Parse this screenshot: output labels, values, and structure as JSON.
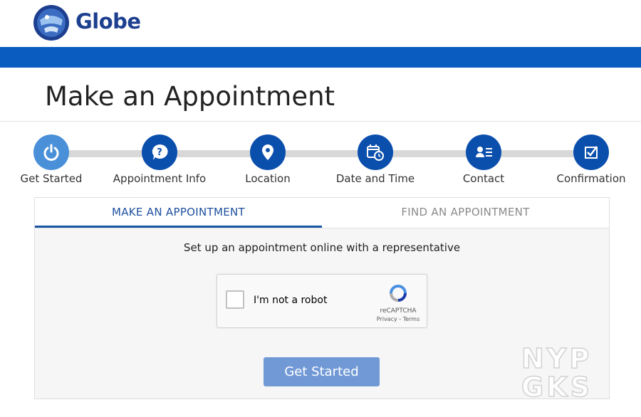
{
  "brand": {
    "name": "Globe",
    "color": "#1d3f8f",
    "bar_color": "#0b5cc0"
  },
  "page": {
    "title": "Make an Appointment"
  },
  "steps": [
    {
      "label": "Get Started",
      "icon": "power-icon",
      "active": true
    },
    {
      "label": "Appointment Info",
      "icon": "question-bubble-icon",
      "active": false
    },
    {
      "label": "Location",
      "icon": "location-pin-icon",
      "active": false
    },
    {
      "label": "Date and Time",
      "icon": "calendar-clock-icon",
      "active": false
    },
    {
      "label": "Contact",
      "icon": "contact-card-icon",
      "active": false
    },
    {
      "label": "Confirmation",
      "icon": "checkbox-icon",
      "active": false
    }
  ],
  "tabs": [
    {
      "label": "MAKE AN APPOINTMENT",
      "active": true
    },
    {
      "label": "FIND AN APPOINTMENT",
      "active": false
    }
  ],
  "form": {
    "subtitle": "Set up an appointment online with a representative",
    "captcha": {
      "label": "I'm not a robot",
      "brand": "reCAPTCHA",
      "links": "Privacy - Terms"
    },
    "submit_label": "Get Started"
  },
  "watermark": {
    "line1": "NYP",
    "line2": "GKS"
  }
}
